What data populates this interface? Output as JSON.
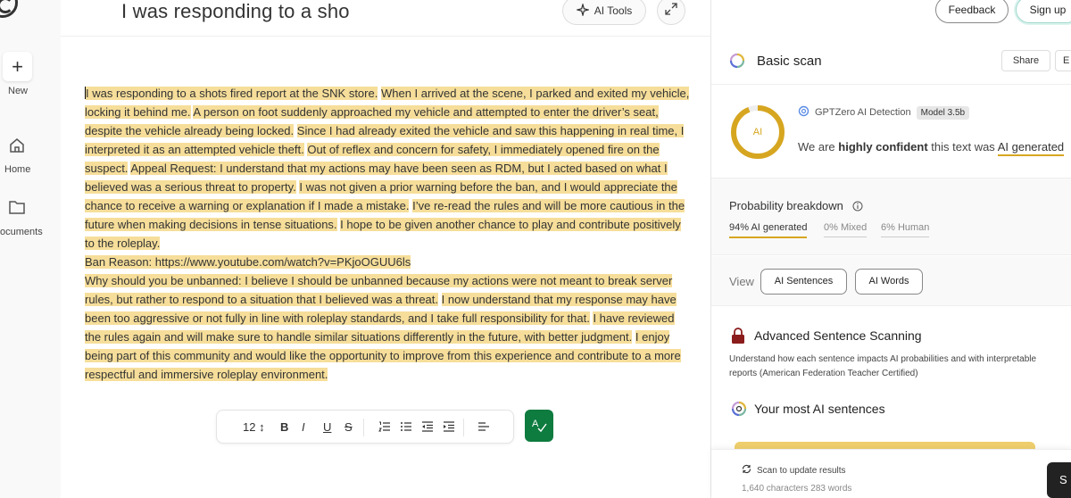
{
  "rail": {
    "new_label": "New",
    "home_label": "Home",
    "documents_label": "ocuments"
  },
  "editor": {
    "title": "I was responding to a sho",
    "ai_tools_label": "AI Tools",
    "toolbar": {
      "font_size": "12 ↕",
      "bold": "B",
      "italic": "I",
      "underline": "U",
      "strike": "S"
    },
    "paragraphs": [
      [
        {
          "t": "I was responding to a shots fired report at the SNK store.",
          "h": true
        },
        {
          "t": " ",
          "h": false
        },
        {
          "t": "When I arrived at the scene, I parked and exited my vehicle, locking it behind me.",
          "h": true
        },
        {
          "t": " ",
          "h": false
        },
        {
          "t": "A person on foot suddenly approached my vehicle and attempted to enter the driver’s seat, despite the vehicle already being locked.",
          "h": true
        },
        {
          "t": " ",
          "h": false
        },
        {
          "t": "Since I had already exited the vehicle and saw this happening in real time, I interpreted it as an attempted vehicle theft.",
          "h": true
        },
        {
          "t": " ",
          "h": false
        },
        {
          "t": "Out of reflex and concern for safety, I immediately opened fire on the suspect.",
          "h": true
        },
        {
          "t": " ",
          "h": false
        },
        {
          "t": "Appeal Request: I understand that my actions may have been seen as RDM, but I acted based on what I believed was a serious threat to property.",
          "h": true
        },
        {
          "t": " ",
          "h": false
        },
        {
          "t": "I was not given a prior warning before the ban, and I would appreciate the chance to receive a warning or explanation if I made a mistake.",
          "h": true
        },
        {
          "t": " ",
          "h": false
        },
        {
          "t": "I’ve re-read the rules and will be more cautious in the future when making decisions in tense situations.",
          "h": true
        },
        {
          "t": " ",
          "h": false
        },
        {
          "t": "I hope to be given another chance to play and contribute positively to the roleplay.",
          "h": true
        }
      ],
      [
        {
          "t": "Ban Reason: https://www.youtube.com/watch?v=PKjoOGUU6ls",
          "h": true
        }
      ],
      [
        {
          "t": "Why should you be unbanned: I believe I should be unbanned because my actions were not meant to break server rules, but rather to respond to a situation that I believed was a threat.",
          "h": true
        },
        {
          "t": " ",
          "h": false
        },
        {
          "t": "I now understand that my response may have been too aggressive or not fully in line with roleplay standards, and I take full responsibility for that.",
          "h": true
        },
        {
          "t": " ",
          "h": false
        },
        {
          "t": "I have reviewed the rules again and will make sure to handle similar situations differently in the future, with better judgment.",
          "h": true
        },
        {
          "t": " ",
          "h": false
        },
        {
          "t": "I enjoy being part of this community and would like the opportunity to improve from this experience and contribute to a more respectful and immersive roleplay environment.",
          "h": true
        }
      ]
    ]
  },
  "topbar": {
    "feedback_label": "Feedback",
    "signup_label": "Sign up"
  },
  "scan": {
    "title": "Basic scan",
    "share_label": "Share",
    "e_label": "E",
    "gauge_label": "AI",
    "ai_fraction": 0.94,
    "detector_name": "GPTZero AI Detection",
    "model_badge": "Model 3.5b",
    "verdict_pre": "We are ",
    "verdict_bold": "highly confident",
    "verdict_mid": " this text was ",
    "verdict_result": "AI generated"
  },
  "probability": {
    "title": "Probability breakdown",
    "ai": "94% AI generated",
    "mixed": "0% Mixed",
    "human": "6% Human"
  },
  "view": {
    "label": "View",
    "sentences_button": "AI Sentences",
    "words_button": "AI Words"
  },
  "advanced": {
    "title": "Advanced Sentence Scanning",
    "description": "Understand how each sentence impacts AI probabilities and with interpretable reports (American Federation Teacher Certified)",
    "most_title": "Your most AI sentences"
  },
  "footer": {
    "scan_update": "Scan to update results",
    "counts": "1,640 characters 283 words",
    "button_label": "S"
  },
  "colors": {
    "highlight": "#f6de9a",
    "accent": "#d7a620",
    "grammar": "#0e7b3f"
  }
}
